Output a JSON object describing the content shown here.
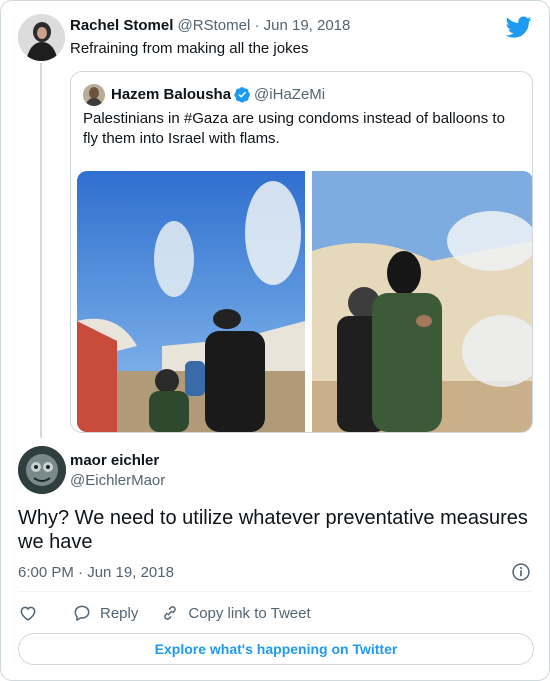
{
  "parent": {
    "name": "Rachel Stomel",
    "handle_date": "@RStomel · Jun 19, 2018",
    "text": "Refraining from making all the jokes"
  },
  "quoted": {
    "name": "Hazem Balousha",
    "handle": "@iHaZeMi",
    "text": "Palestinians in #Gaza are using condoms instead of balloons to fly them into Israel with flams."
  },
  "reply": {
    "name": "maor eichler",
    "handle": "@EichlerMaor",
    "text": "Why? We need to utilize whatever preventative measures we have",
    "timestamp": "6:00 PM · Jun 19, 2018"
  },
  "actions": {
    "reply_label": "Reply",
    "copy_label": "Copy link to Tweet"
  },
  "footer": {
    "explore_label": "Explore what's happening on Twitter"
  },
  "colors": {
    "twitter_blue": "#1d9bf0",
    "text_muted": "#536471",
    "border": "#cfd9de"
  },
  "icons": [
    "twitter-bird-icon",
    "verified-badge-icon",
    "info-icon",
    "heart-icon",
    "reply-icon",
    "link-icon"
  ]
}
